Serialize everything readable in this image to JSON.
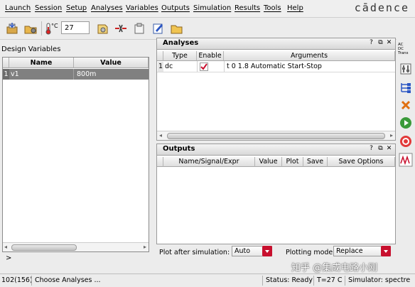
{
  "menu": [
    "Launch",
    "Session",
    "Setup",
    "Analyses",
    "Variables",
    "Outputs",
    "Simulation",
    "Results",
    "Tools",
    "Help"
  ],
  "brand": "cādence",
  "toolbar": {
    "temperature_unit": "°C",
    "temperature_value": "27"
  },
  "design_variables": {
    "title": "Design Variables",
    "columns": [
      "Name",
      "Value"
    ],
    "rows": [
      {
        "index": "1",
        "name": "v1",
        "value": "800m"
      }
    ]
  },
  "analyses": {
    "title": "Analyses",
    "controls": [
      "?",
      "⧉",
      "✕"
    ],
    "columns": [
      "Type",
      "Enable",
      "Arguments"
    ],
    "rows": [
      {
        "index": "1",
        "type": "dc",
        "enabled": true,
        "arguments": "t 0 1.8 Automatic Start-Stop"
      }
    ]
  },
  "outputs": {
    "title": "Outputs",
    "controls": [
      "?",
      "⧉",
      "✕"
    ],
    "columns": [
      "Name/Signal/Expr",
      "Value",
      "Plot",
      "Save",
      "Save Options"
    ]
  },
  "bottom": {
    "plot_after_label": "Plot after simulation:",
    "plot_after_value": "Auto",
    "plotting_mode_label": "Plotting mode:",
    "plotting_mode_value": "Replace"
  },
  "prompt_marker": ">",
  "sidebar_labels": {
    "ac": "AC",
    "dc": "DC",
    "trans": "Trans"
  },
  "status": {
    "counter": "102(156)",
    "message": "Choose Analyses ...",
    "state": "Status: Ready",
    "temp": "T=27 C",
    "simulator": "Simulator: spectre"
  },
  "watermark": "知乎 @集成电路小刚",
  "colors": {
    "accent_red": "#c8102e",
    "selection_gray": "#808080",
    "run_green": "#3a9a3a"
  }
}
